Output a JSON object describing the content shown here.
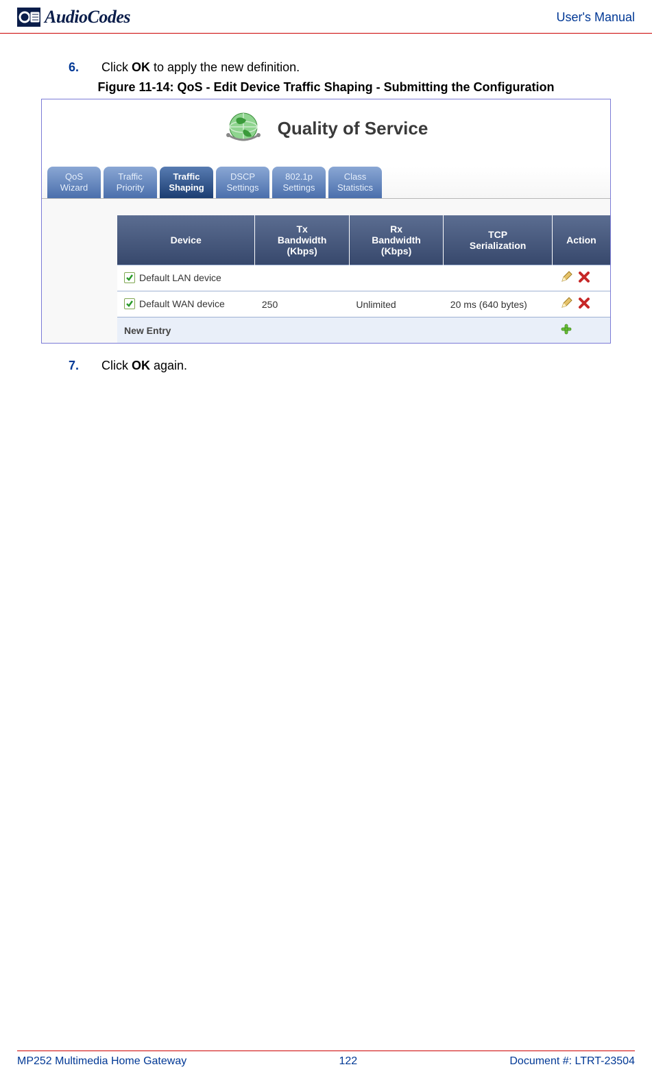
{
  "header": {
    "brand": "AudioCodes",
    "doc_type": "User's Manual"
  },
  "steps": [
    {
      "num": "6.",
      "prefix": "Click ",
      "bold": "OK",
      "suffix": " to apply the new definition."
    },
    {
      "num": "7.",
      "prefix": "Click ",
      "bold": "OK",
      "suffix": " again."
    }
  ],
  "figure": {
    "caption": "Figure 11-14: QoS - Edit Device Traffic Shaping - Submitting the Configuration",
    "title": "Quality of Service",
    "tabs": [
      {
        "line1": "QoS",
        "line2": "Wizard",
        "active": false
      },
      {
        "line1": "Traffic",
        "line2": "Priority",
        "active": false
      },
      {
        "line1": "Traffic",
        "line2": "Shaping",
        "active": true
      },
      {
        "line1": "DSCP",
        "line2": "Settings",
        "active": false
      },
      {
        "line1": "802.1p",
        "line2": "Settings",
        "active": false
      },
      {
        "line1": "Class",
        "line2": "Statistics",
        "active": false
      }
    ],
    "table": {
      "headers": [
        "Device",
        "Tx Bandwidth (Kbps)",
        "Rx Bandwidth (Kbps)",
        "TCP Serialization",
        "Action"
      ],
      "rows": [
        {
          "device": "Default LAN device",
          "tx": "",
          "rx": "",
          "tcp": "",
          "actions": [
            "edit",
            "delete"
          ]
        },
        {
          "device": "Default WAN device",
          "tx": "250",
          "rx": "Unlimited",
          "tcp": "20 ms (640 bytes)",
          "actions": [
            "edit",
            "delete"
          ]
        }
      ],
      "new_entry_label": "New Entry"
    }
  },
  "footer": {
    "left": "MP252 Multimedia Home Gateway",
    "center": "122",
    "right": "Document #: LTRT-23504"
  }
}
